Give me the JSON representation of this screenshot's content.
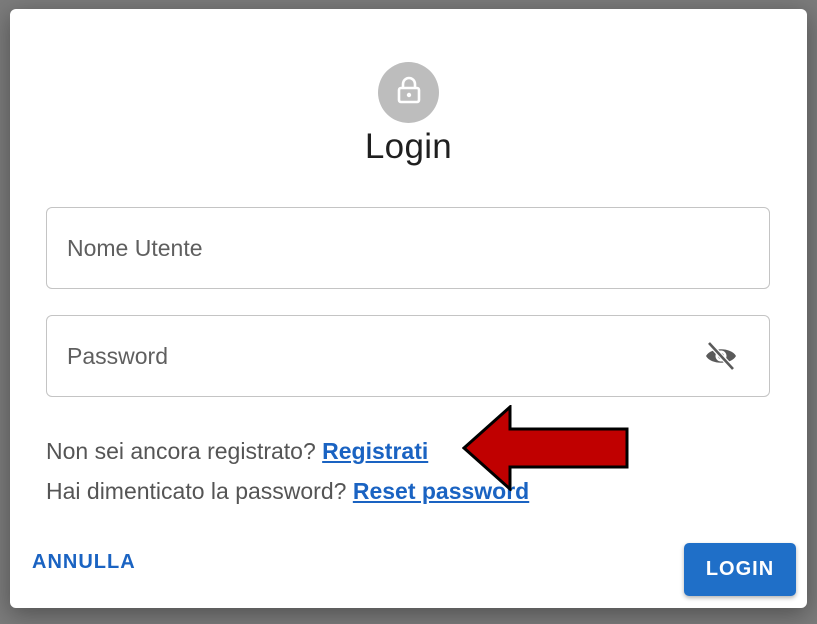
{
  "dialog": {
    "title": "Login",
    "avatar_icon": "lock-icon"
  },
  "fields": {
    "username_placeholder": "Nome Utente",
    "password_placeholder": "Password",
    "password_toggle_icon": "eye-off-icon"
  },
  "links": {
    "register_prompt": "Non sei ancora registrato?",
    "register_link": "Registrati",
    "reset_prompt": "Hai dimenticato la password?",
    "reset_link": "Reset password"
  },
  "actions": {
    "cancel_label": "ANNULLA",
    "login_label": "LOGIN"
  },
  "colors": {
    "accent": "#1a63c2",
    "annotation_arrow": "#c00000"
  }
}
